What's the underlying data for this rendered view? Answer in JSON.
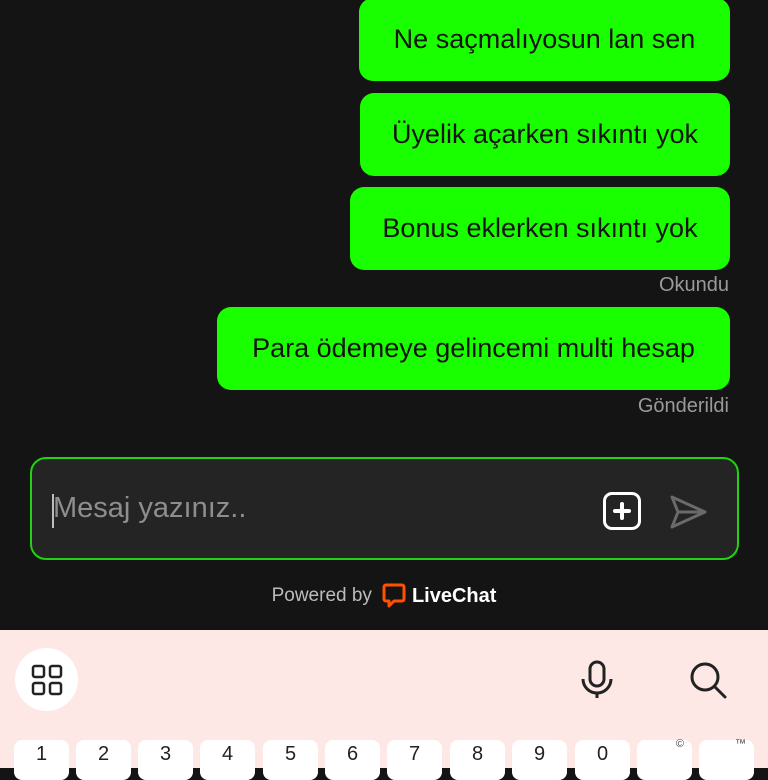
{
  "messages": [
    {
      "text": "Ne saçmalıyosun lan sen"
    },
    {
      "text": "Üyelik açarken sıkıntı yok"
    },
    {
      "text": "Bonus eklerken sıkıntı yok"
    },
    {
      "text": "Para ödemeye gelincemi multi hesap"
    }
  ],
  "status": {
    "read": "Okundu",
    "sent": "Gönderildi"
  },
  "composer": {
    "placeholder": "Mesaj yazınız..",
    "add_icon": "plus-square-icon",
    "send_icon": "send-icon"
  },
  "footer": {
    "powered_by": "Powered by",
    "brand": "LiveChat"
  },
  "keyboard": {
    "number_keys": [
      "1",
      "2",
      "3",
      "4",
      "5",
      "6",
      "7",
      "8",
      "9",
      "0",
      "",
      ""
    ],
    "symbol_hints": [
      "©",
      "™"
    ],
    "icons": [
      "grid-icon",
      "microphone-icon",
      "search-icon"
    ]
  },
  "colors": {
    "bubble": "#1aff00",
    "accent_border": "#22d10f",
    "brand_orange": "#ff5100",
    "background": "#141414",
    "keyboard_bg": "#fde8e6"
  }
}
